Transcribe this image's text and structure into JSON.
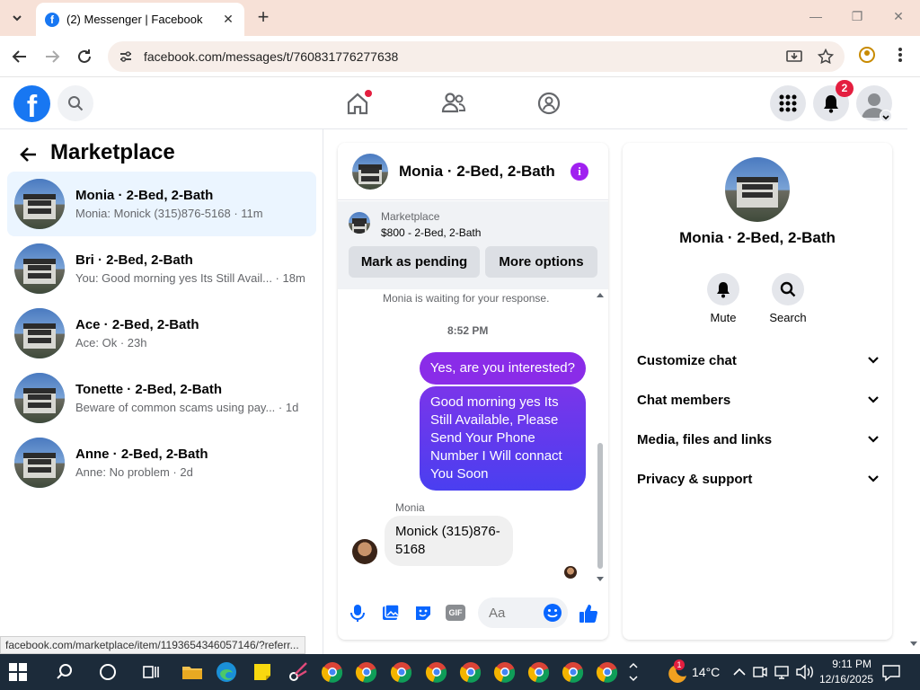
{
  "browser": {
    "tab_title": "(2) Messenger | Facebook",
    "tab_favicon": "f",
    "url": "facebook.com/messages/t/760831776277638",
    "status_url": "facebook.com/marketplace/item/1193654346057146/?referr..."
  },
  "fb": {
    "logo": "f",
    "notification_count": "2",
    "colors": {
      "brand": "#1877f2",
      "accent": "#a020f0",
      "badge": "#e41e3f"
    }
  },
  "sidebar": {
    "title": "Marketplace",
    "conversations": [
      {
        "name": "Monia · 2-Bed, 2-Bath",
        "preview": "Monia: Monick (315)876-5168 · 11m"
      },
      {
        "name": "Bri · 2-Bed, 2-Bath",
        "preview": "You: Good morning yes Its Still Avail... · 18m"
      },
      {
        "name": "Ace · 2-Bed, 2-Bath",
        "preview": "Ace: Ok · 23h"
      },
      {
        "name": "Tonette · 2-Bed, 2-Bath",
        "preview": "Beware of common scams using pay... · 1d"
      },
      {
        "name": "Anne · 2-Bed, 2-Bath",
        "preview": "Anne: No problem · 2d"
      }
    ]
  },
  "chat": {
    "name": "Monia · 2-Bed, 2-Bath",
    "listing_label": "Marketplace",
    "listing_price": "$800 - 2-Bed, 2-Bath",
    "mark_pending": "Mark as pending",
    "more_options": "More options",
    "waiting": "Monia is waiting for your response.",
    "time": "8:52 PM",
    "out1": "Yes, are you interested?",
    "out2": "Good morning yes Its Still Available, Please Send Your Phone Number I Will connact You Soon",
    "sender": "Monia",
    "in1": "Monick (315)876-5168",
    "input_placeholder": "Aa",
    "gif_label": "GIF"
  },
  "panel": {
    "name": "Monia · 2-Bed, 2-Bath",
    "mute": "Mute",
    "search": "Search",
    "rows": [
      "Customize chat",
      "Chat members",
      "Media, files and links",
      "Privacy & support"
    ]
  },
  "taskbar": {
    "temperature": "14°C",
    "weather_badge": "1",
    "time": "9:11 PM",
    "date": "12/16/2025"
  }
}
